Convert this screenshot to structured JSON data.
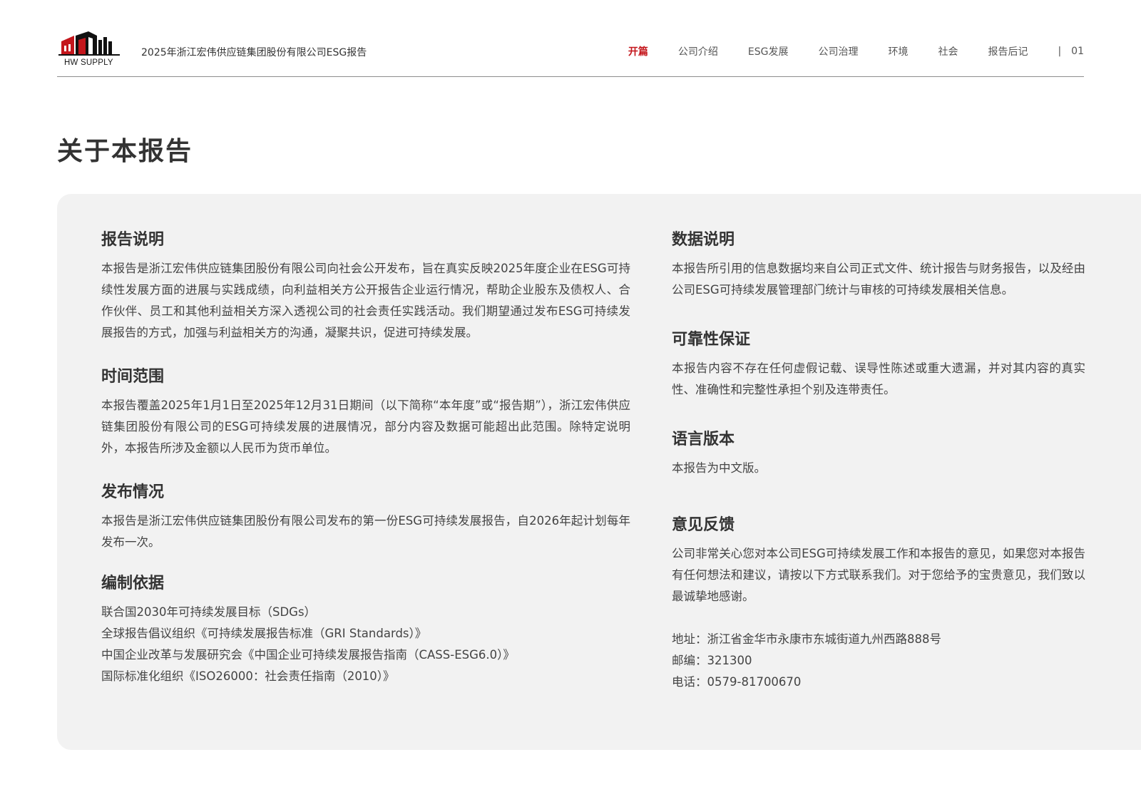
{
  "header": {
    "logo_text": "HW SUPPLY",
    "report_title": "2025年浙江宏伟供应链集团股份有限公司ESG报告",
    "nav": [
      "开篇",
      "公司介绍",
      "ESG发展",
      "公司治理",
      "环境",
      "社会",
      "报告后记"
    ],
    "nav_active": "开篇",
    "separator": "|",
    "page_number": "01"
  },
  "page_title": "关于本报告",
  "left": {
    "report_desc": {
      "title": "报告说明",
      "text": "本报告是浙江宏伟供应链集团股份有限公司向社会公开发布，旨在真实反映2025年度企业在ESG可持续性发展方面的进展与实践成绩，向利益相关方公开报告企业运行情况，帮助企业股东及债权人、合作伙伴、员工和其他利益相关方深入透视公司的社会责任实践活动。我们期望通过发布ESG可持续发展报告的方式，加强与利益相关方的沟通，凝聚共识，促进可持续发展。"
    },
    "time_scope": {
      "title": "时间范围",
      "text": "本报告覆盖2025年1月1日至2025年12月31日期间（以下简称“本年度”或“报告期”），浙江宏伟供应链集团股份有限公司的ESG可持续发展的进展情况，部分内容及数据可能超出此范围。除特定说明外，本报告所涉及金额以人民币为货币单位。"
    },
    "release": {
      "title": "发布情况",
      "text": "本报告是浙江宏伟供应链集团股份有限公司发布的第一份ESG可持续发展报告，自2026年起计划每年发布一次。"
    },
    "basis": {
      "title": "编制依据",
      "items": [
        "联合国2030年可持续发展目标（SDGs）",
        "全球报告倡议组织《可持续发展报告标准（GRI Standards）》",
        "中国企业改革与发展研究会《中国企业可持续发展报告指南（CASS-ESG6.0）》",
        "国际标准化组织《ISO26000：社会责任指南（2010）》"
      ]
    }
  },
  "right": {
    "data_desc": {
      "title": "数据说明",
      "text": "本报告所引用的信息数据均来自公司正式文件、统计报告与财务报告，以及经由公司ESG可持续发展管理部门统计与审核的可持续发展相关信息。"
    },
    "reliability": {
      "title": "可靠性保证",
      "text": "本报告内容不存在任何虚假记载、误导性陈述或重大遗漏，并对其内容的真实性、准确性和完整性承担个别及连带责任。"
    },
    "language": {
      "title": "语言版本",
      "text": "本报告为中文版。"
    },
    "feedback": {
      "title": "意见反馈",
      "text": "公司非常关心您对本公司ESG可持续发展工作和本报告的意见，如果您对本报告有任何想法和建议，请按以下方式联系我们。对于您给予的宝贵意见，我们致以最诚挚地感谢。",
      "address": "地址：浙江省金华市永康市东城街道九州西路888号",
      "postcode": "邮编：321300",
      "phone": "电话：0579-81700670"
    }
  },
  "colors": {
    "accent": "#c4161c",
    "panel_bg": "#f2f2f2",
    "text": "#3a3a3a"
  }
}
